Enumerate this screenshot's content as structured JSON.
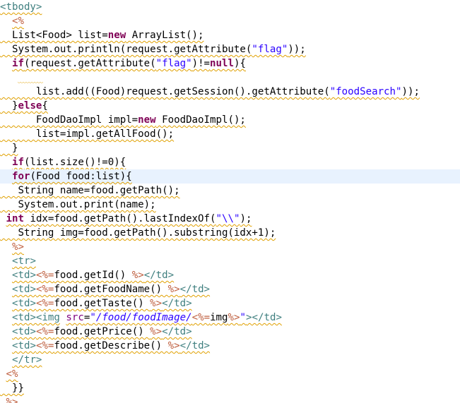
{
  "editor": {
    "lines": [
      {
        "tokens": [
          {
            "t": "<tbody>",
            "c": "tag"
          }
        ]
      },
      {
        "tokens": [
          {
            "t": "  "
          },
          {
            "t": "<%",
            "c": "jsp"
          }
        ]
      },
      {
        "tokens": [
          {
            "t": "  List<Food> list="
          },
          {
            "t": "new",
            "c": "kw"
          },
          {
            "t": " ArrayList();"
          }
        ]
      },
      {
        "tokens": [
          {
            "t": "  System.out.println(request.getAttribute("
          },
          {
            "t": "\"flag\"",
            "c": "str"
          },
          {
            "t": "));"
          }
        ]
      },
      {
        "tokens": [
          {
            "t": "  "
          },
          {
            "t": "if",
            "c": "kw"
          },
          {
            "t": "(request.getAttribute("
          },
          {
            "t": "\"flag\"",
            "c": "str"
          },
          {
            "t": ")!="
          },
          {
            "t": "null",
            "c": "kw"
          },
          {
            "t": "){"
          }
        ]
      },
      {
        "tokens": [
          {
            "t": "        "
          }
        ]
      },
      {
        "tokens": [
          {
            "t": "      list.add((Food)request.getSession().getAttribute("
          },
          {
            "t": "\"foodSearch\"",
            "c": "str"
          },
          {
            "t": "));"
          }
        ]
      },
      {
        "tokens": [
          {
            "t": "  }"
          },
          {
            "t": "else",
            "c": "kw"
          },
          {
            "t": "{"
          }
        ]
      },
      {
        "tokens": [
          {
            "t": "      FoodDaoImpl impl="
          },
          {
            "t": "new",
            "c": "kw"
          },
          {
            "t": " FoodDaoImpl();"
          }
        ]
      },
      {
        "tokens": [
          {
            "t": "      list=impl.getAllFood();"
          }
        ]
      },
      {
        "tokens": [
          {
            "t": "  }"
          }
        ]
      },
      {
        "tokens": [
          {
            "t": "  "
          },
          {
            "t": "if",
            "c": "kw"
          },
          {
            "t": "(list.size()!=0){"
          }
        ]
      },
      {
        "tokens": [
          {
            "t": "  "
          },
          {
            "t": "for",
            "c": "kw"
          },
          {
            "t": "(Food food:list){"
          }
        ]
      },
      {
        "tokens": [
          {
            "t": "   String name=food.getPath();"
          }
        ]
      },
      {
        "tokens": [
          {
            "t": "   System.out.print(name);"
          }
        ]
      },
      {
        "tokens": [
          {
            "t": " "
          },
          {
            "t": "int",
            "c": "kw"
          },
          {
            "t": " idx=food.getPath().lastIndexOf("
          },
          {
            "t": "\"\\\\\"",
            "c": "str"
          },
          {
            "t": ");"
          }
        ]
      },
      {
        "tokens": [
          {
            "t": "   String img=food.getPath().substring(idx+1);"
          }
        ]
      },
      {
        "tokens": [
          {
            "t": "  "
          },
          {
            "t": "%>",
            "c": "jsp"
          }
        ]
      },
      {
        "tokens": [
          {
            "t": "  "
          },
          {
            "t": "<tr>",
            "c": "tag"
          }
        ]
      },
      {
        "tokens": [
          {
            "t": "  "
          },
          {
            "t": "<td>",
            "c": "tag"
          },
          {
            "t": "<%=",
            "c": "jsp"
          },
          {
            "t": "food.getId() "
          },
          {
            "t": "%>",
            "c": "jsp"
          },
          {
            "t": "</td>",
            "c": "tag"
          }
        ]
      },
      {
        "tokens": [
          {
            "t": "  "
          },
          {
            "t": "<td>",
            "c": "tag"
          },
          {
            "t": "<%=",
            "c": "jsp"
          },
          {
            "t": "food.getFoodName() "
          },
          {
            "t": "%>",
            "c": "jsp"
          },
          {
            "t": "</td>",
            "c": "tag"
          }
        ]
      },
      {
        "tokens": [
          {
            "t": "  "
          },
          {
            "t": "<td>",
            "c": "tag"
          },
          {
            "t": "<%=",
            "c": "jsp"
          },
          {
            "t": "food.getTaste() "
          },
          {
            "t": "%>",
            "c": "jsp"
          },
          {
            "t": "</td>",
            "c": "tag"
          }
        ]
      },
      {
        "tokens": [
          {
            "t": "  "
          },
          {
            "t": "<td><img",
            "c": "tag"
          },
          {
            "t": " "
          },
          {
            "t": "src",
            "c": "attr"
          },
          {
            "t": "="
          },
          {
            "t": "\"/food/foodImage/",
            "c": "ival"
          },
          {
            "t": "<%=",
            "c": "jsp"
          },
          {
            "t": "img"
          },
          {
            "t": "%>",
            "c": "jsp"
          },
          {
            "t": "\"",
            "c": "ival"
          },
          {
            "t": "></td>",
            "c": "tag"
          }
        ]
      },
      {
        "tokens": [
          {
            "t": "  "
          },
          {
            "t": "<td>",
            "c": "tag"
          },
          {
            "t": "<%=",
            "c": "jsp"
          },
          {
            "t": "food.getPrice() "
          },
          {
            "t": "%>",
            "c": "jsp"
          },
          {
            "t": "</td>",
            "c": "tag"
          }
        ]
      },
      {
        "tokens": [
          {
            "t": "  "
          },
          {
            "t": "<td>",
            "c": "tag"
          },
          {
            "t": "<%=",
            "c": "jsp"
          },
          {
            "t": "food.getDescribe() "
          },
          {
            "t": "%>",
            "c": "jsp"
          },
          {
            "t": "</td>",
            "c": "tag"
          }
        ]
      },
      {
        "tokens": [
          {
            "t": "  "
          },
          {
            "t": "</tr>",
            "c": "tag"
          }
        ]
      },
      {
        "tokens": [
          {
            "t": " "
          },
          {
            "t": "<%",
            "c": "jsp"
          }
        ]
      },
      {
        "tokens": [
          {
            "t": "  }}"
          }
        ]
      },
      {
        "tokens": [
          {
            "t": " "
          },
          {
            "t": "%>",
            "c": "jsp"
          }
        ]
      }
    ],
    "current_line_index": 12,
    "colors": {
      "keyword": "#7f0055",
      "string": "#2a00ff",
      "tag": "#3f7f7f",
      "jsp_delimiter": "#bf5f3f",
      "attribute": "#7f007f",
      "warning_underline": "#e0a000",
      "current_line": "#e8f2fe"
    }
  }
}
